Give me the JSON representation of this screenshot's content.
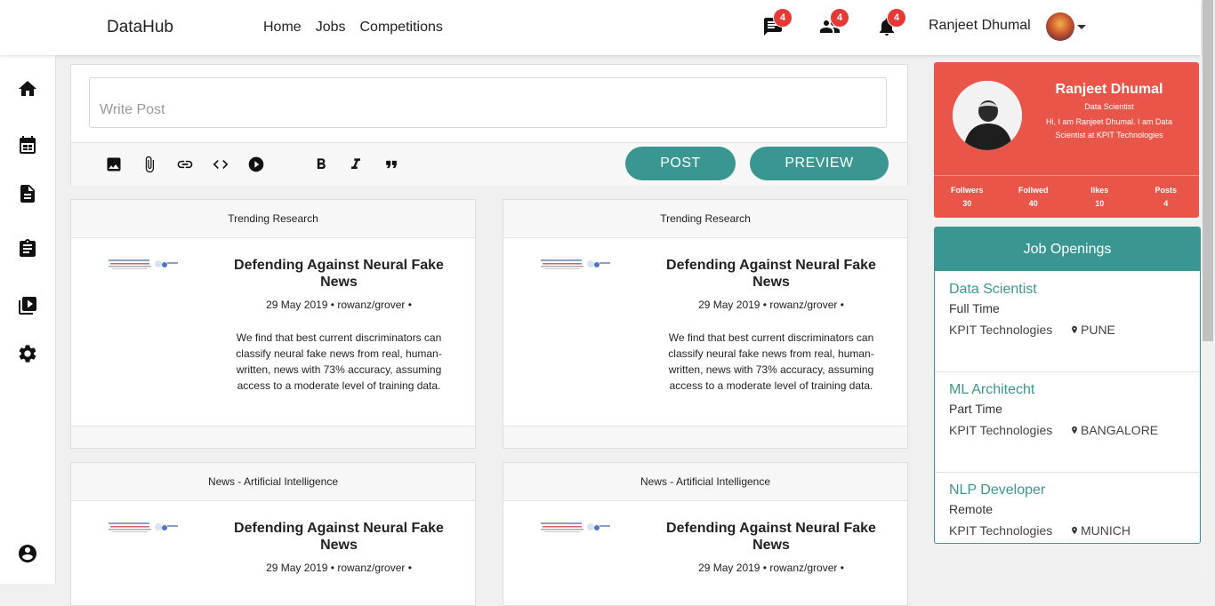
{
  "brand": "DataHub",
  "nav": {
    "home": "Home",
    "jobs": "Jobs",
    "competitions": "Competitions"
  },
  "badges": {
    "messages": "4",
    "friends": "4",
    "notifications": "4"
  },
  "user": {
    "name": "Ranjeet Dhumal"
  },
  "composer": {
    "placeholder": "Write Post",
    "post_label": "POST",
    "preview_label": "PREVIEW",
    "tools": [
      "image-icon",
      "attachment-icon",
      "link-icon",
      "code-icon",
      "play-icon",
      "bold-icon",
      "italic-icon",
      "quote-icon"
    ]
  },
  "cards": [
    {
      "header": "Trending Research",
      "title": "Defending Against Neural Fake News",
      "meta": "29 May 2019 • rowanz/grover •",
      "desc": "We find that best current discriminators can classify neural fake news from real, human-written, news with 73% accuracy, assuming access to a moderate level of training data."
    },
    {
      "header": "Trending Research",
      "title": "Defending Against Neural Fake News",
      "meta": "29 May 2019 • rowanz/grover •",
      "desc": "We find that best current discriminators can classify neural fake news from real, human-written, news with 73% accuracy, assuming access to a moderate level of training data."
    },
    {
      "header": "News - Artificial Intelligence",
      "title": "Defending Against Neural Fake News",
      "meta": "29 May 2019 • rowanz/grover •",
      "desc": ""
    },
    {
      "header": "News - Artificial Intelligence",
      "title": "Defending Against Neural Fake News",
      "meta": "29 May 2019 • rowanz/grover •",
      "desc": ""
    }
  ],
  "profile": {
    "name": "Ranjeet Dhumal",
    "role": "Data Scientist",
    "bio": "Hi, I am Ranjeet Dhumal. I am Data Scientist at KPIT Technologies",
    "stats": [
      {
        "label": "Follwers",
        "value": "30"
      },
      {
        "label": "Follwed",
        "value": "40"
      },
      {
        "label": "likes",
        "value": "10"
      },
      {
        "label": "Posts",
        "value": "4"
      }
    ]
  },
  "jobs": {
    "title": "Job Openings",
    "items": [
      {
        "title": "Data Scientist",
        "type": "Full Time",
        "company": "KPIT Technologies",
        "location": "PUNE"
      },
      {
        "title": "ML Architecht",
        "type": "Part Time",
        "company": "KPIT Technologies",
        "location": "BANGALORE"
      },
      {
        "title": "NLP Developer",
        "type": "Remote",
        "company": "KPIT Technologies",
        "location": "MUNICH"
      }
    ]
  },
  "colors": {
    "accent": "#3a9690",
    "profile_bg": "#ea5549",
    "badge": "#e53935"
  }
}
